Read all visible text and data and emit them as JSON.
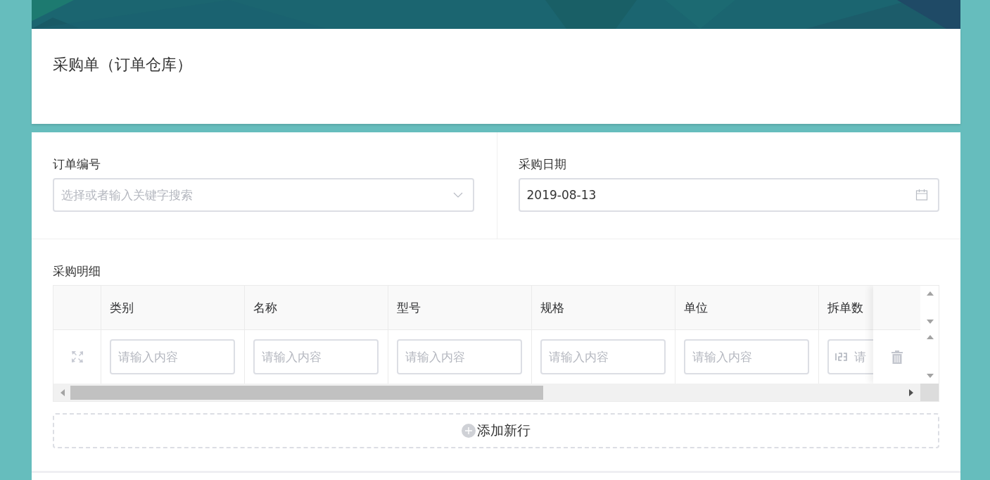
{
  "header": {
    "title": "采购单（订单仓库）"
  },
  "fields": [
    {
      "label": "订单编号",
      "kind": "select",
      "placeholder": "选择或者输入关键字搜索"
    },
    {
      "label": "采购日期",
      "kind": "date",
      "value": "2019-08-13"
    }
  ],
  "details": {
    "title": "采购明细",
    "columns": [
      "类别",
      "名称",
      "型号",
      "规格",
      "单位",
      "拆单数"
    ],
    "rows": [
      {
        "cells": [
          {
            "kind": "text",
            "placeholder": "请输入内容"
          },
          {
            "kind": "text",
            "placeholder": "请输入内容"
          },
          {
            "kind": "text",
            "placeholder": "请输入内容"
          },
          {
            "kind": "text",
            "placeholder": "请输入内容"
          },
          {
            "kind": "text",
            "placeholder": "请输入内容"
          },
          {
            "kind": "number",
            "placeholder": "请"
          }
        ]
      }
    ]
  },
  "add_button": "添加新行"
}
